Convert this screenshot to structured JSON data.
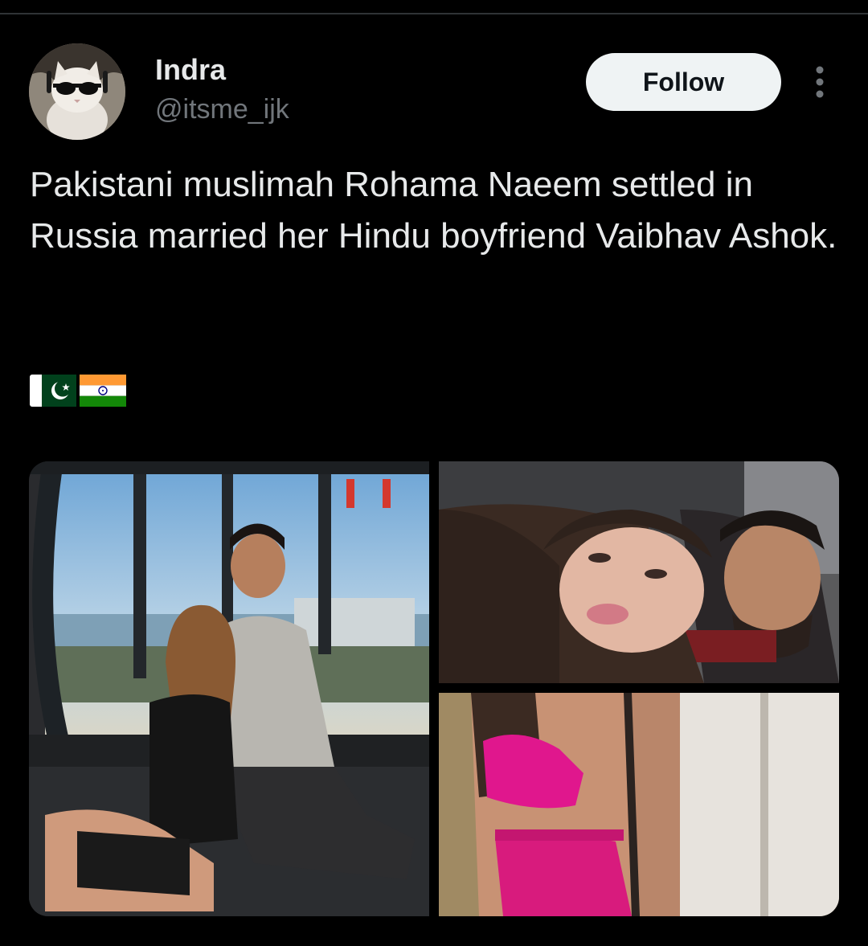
{
  "tweet": {
    "author": {
      "display_name": "Indra",
      "handle": "@itsme_ijk",
      "avatar_icon": "cat-with-sunglasses-avatar"
    },
    "follow_label": "Follow",
    "more_icon": "more-vertical-icon",
    "text": "Pakistani muslimah Rohama Naeem settled in Russia married her Hindu boyfriend Vaibhav Ashok.",
    "flags": [
      "🇵🇰",
      "🇮🇳"
    ],
    "media": [
      {
        "icon": "photo-couple-ferris-wheel"
      },
      {
        "icon": "photo-couple-selfie"
      },
      {
        "icon": "photo-pink-bikini-mirror"
      }
    ]
  },
  "colors": {
    "background": "#000000",
    "primary_text": "#e7e9ea",
    "secondary_text": "#71767b",
    "follow_button_bg": "#eff3f4",
    "follow_button_text": "#0f1419",
    "divider": "#2f3336"
  }
}
